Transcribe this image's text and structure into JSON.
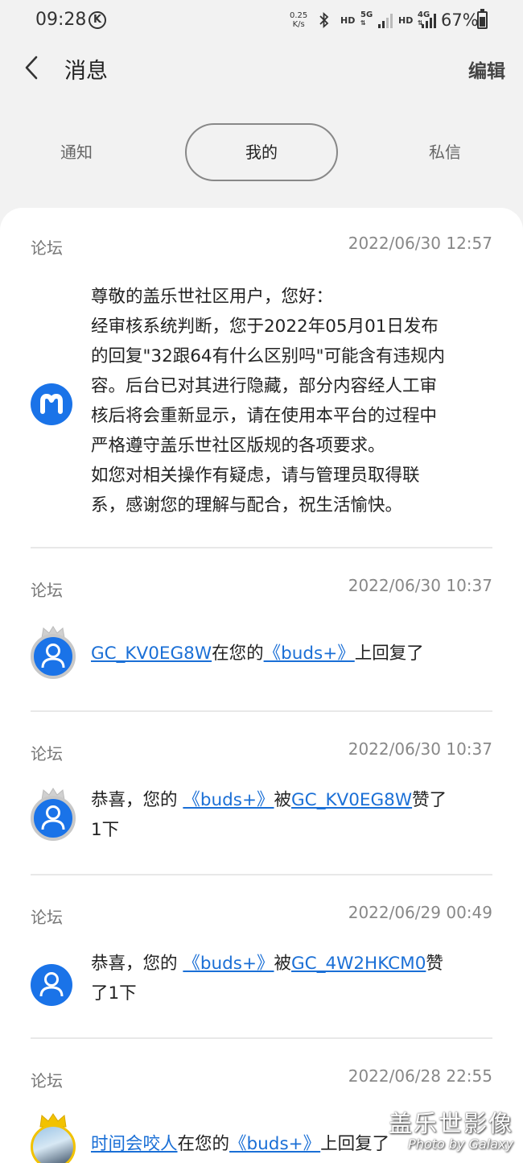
{
  "status_bar": {
    "time": "09:28",
    "k_badge": "K",
    "net_speed_value": "0.25",
    "net_speed_unit": "K/s",
    "hd1": "HD",
    "net1": "5G",
    "hd2": "HD",
    "net2": "4G",
    "battery": "67%"
  },
  "header": {
    "title": "消息",
    "edit_label": "编辑"
  },
  "tabs": [
    {
      "label": "通知"
    },
    {
      "label": "我的"
    },
    {
      "label": "私信"
    }
  ],
  "messages": [
    {
      "category": "论坛",
      "time": "2022/06/30 12:57",
      "avatar": "m-icon",
      "lines": [
        "尊敬的盖乐世社区用户，您好：",
        "经审核系统判断，您于2022年05月01日发布",
        "的回复\"32跟64有什么区别吗\"可能含有违规内",
        "容。后台已对其进行隐藏，部分内容经人工审",
        "核后将会重新显示，请在使用本平台的过程中",
        "严格遵守盖乐世社区版规的各项要求。",
        "如您对相关操作有疑虑，请与管理员取得联",
        "系，感谢您的理解与配合，祝生活愉快。"
      ]
    },
    {
      "category": "论坛",
      "time": "2022/06/30 10:37",
      "avatar": "user-icon",
      "user": "GC_KV0EG8W",
      "text_mid": "在您的",
      "post": "《buds+》",
      "text_end": "上回复了"
    },
    {
      "category": "论坛",
      "time": "2022/06/30 10:37",
      "avatar": "user-icon",
      "text_start": "恭喜，您的",
      "post": "《buds+》",
      "text_mid": "被",
      "user": "GC_KV0EG8W",
      "text_end_1": "赞了",
      "text_end_2": "1下"
    },
    {
      "category": "论坛",
      "time": "2022/06/29 00:49",
      "avatar": "user-icon",
      "text_start": "恭喜，您的",
      "post": "《buds+》",
      "text_mid": "被",
      "user": "GC_4W2HKCM0",
      "text_end_1": "赞",
      "text_end_2": "了1下"
    },
    {
      "category": "论坛",
      "time": "2022/06/28 22:55",
      "avatar": "photo-avatar",
      "user": "时间会咬人",
      "text_mid": "在您的",
      "post": "《buds+》",
      "text_end": "上回复了"
    }
  ],
  "watermark": {
    "title": "盖乐世影像",
    "subtitle": "Photo by Galaxy"
  },
  "colors": {
    "link": "#1a6fd6",
    "avatar_blue": "#1a73e8",
    "background": "#f2f2f2"
  }
}
